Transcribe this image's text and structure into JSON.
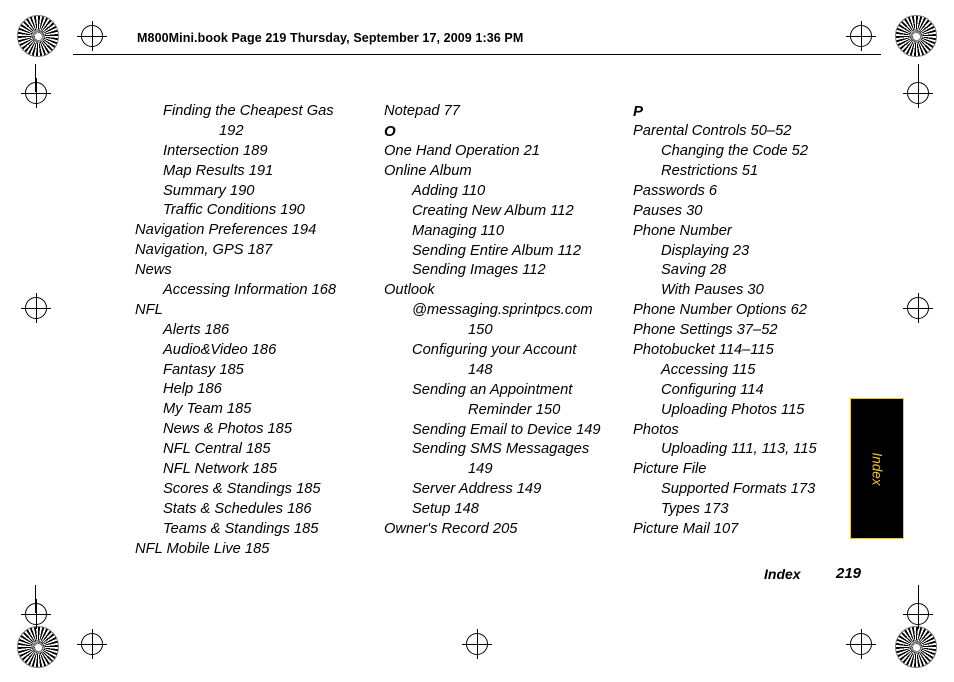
{
  "header": {
    "text": "M800Mini.book  Page 219  Thursday, September 17, 2009  1:36 PM"
  },
  "thumb_tab": {
    "label": "Index",
    "background": "#000000",
    "text_color": "#f5c518"
  },
  "footer": {
    "section": "Index",
    "page_number": "219"
  },
  "columns": [
    {
      "id": "column-1",
      "entries": [
        {
          "level": 1,
          "text": "Finding the Cheapest Gas",
          "cont": "192"
        },
        {
          "level": 1,
          "text": "Intersection 189"
        },
        {
          "level": 1,
          "text": "Map Results 191"
        },
        {
          "level": 1,
          "text": "Summary 190"
        },
        {
          "level": 1,
          "text": "Traffic Conditions 190"
        },
        {
          "level": 0,
          "text": "Navigation Preferences 194"
        },
        {
          "level": 0,
          "text": "Navigation, GPS 187"
        },
        {
          "level": 0,
          "text": "News"
        },
        {
          "level": 1,
          "text": "Accessing Information 168"
        },
        {
          "level": 0,
          "text": "NFL"
        },
        {
          "level": 1,
          "text": "Alerts 186"
        },
        {
          "level": 1,
          "text": "Audio&Video 186"
        },
        {
          "level": 1,
          "text": "Fantasy 185"
        },
        {
          "level": 1,
          "text": "Help 186"
        },
        {
          "level": 1,
          "text": "My Team 185"
        },
        {
          "level": 1,
          "text": "News & Photos 185"
        },
        {
          "level": 1,
          "text": "NFL Central 185"
        },
        {
          "level": 1,
          "text": "NFL Network 185"
        },
        {
          "level": 1,
          "text": "Scores & Standings 185"
        },
        {
          "level": 1,
          "text": "Stats & Schedules 186"
        },
        {
          "level": 1,
          "text": "Teams & Standings 185"
        },
        {
          "level": 0,
          "text": "NFL Mobile Live 185"
        }
      ]
    },
    {
      "id": "column-2",
      "entries": [
        {
          "level": 0,
          "text": "Notepad 77"
        },
        {
          "letter": "O"
        },
        {
          "level": 0,
          "text": "One Hand Operation 21"
        },
        {
          "level": 0,
          "text": "Online Album"
        },
        {
          "level": 1,
          "text": "Adding 110"
        },
        {
          "level": 1,
          "text": "Creating New Album 112"
        },
        {
          "level": 1,
          "text": "Managing 110"
        },
        {
          "level": 1,
          "text": "Sending Entire Album 112"
        },
        {
          "level": 1,
          "text": "Sending Images 112"
        },
        {
          "level": 0,
          "text": "Outlook"
        },
        {
          "level": 1,
          "text": "@messaging.sprintpcs.com",
          "cont": "150"
        },
        {
          "level": 1,
          "text": "Configuring your Account",
          "cont": "148"
        },
        {
          "level": 1,
          "text": "Sending an Appointment",
          "cont": "Reminder 150"
        },
        {
          "level": 1,
          "text": "Sending Email to Device 149"
        },
        {
          "level": 1,
          "text": "Sending SMS Messagages",
          "cont": "149"
        },
        {
          "level": 1,
          "text": "Server Address 149"
        },
        {
          "level": 1,
          "text": "Setup 148"
        },
        {
          "level": 0,
          "text": "Owner's Record 205"
        }
      ]
    },
    {
      "id": "column-3",
      "entries": [
        {
          "letter": "P"
        },
        {
          "level": 0,
          "text": "Parental Controls 50–52"
        },
        {
          "level": 1,
          "text": "Changing the Code 52"
        },
        {
          "level": 1,
          "text": "Restrictions 51"
        },
        {
          "level": 0,
          "text": "Passwords 6"
        },
        {
          "level": 0,
          "text": "Pauses 30"
        },
        {
          "level": 0,
          "text": "Phone Number"
        },
        {
          "level": 1,
          "text": "Displaying 23"
        },
        {
          "level": 1,
          "text": "Saving 28"
        },
        {
          "level": 1,
          "text": "With Pauses 30"
        },
        {
          "level": 0,
          "text": "Phone Number Options 62"
        },
        {
          "level": 0,
          "text": "Phone Settings 37–52"
        },
        {
          "level": 0,
          "text": "Photobucket 114–115"
        },
        {
          "level": 1,
          "text": "Accessing 115"
        },
        {
          "level": 1,
          "text": "Configuring 114"
        },
        {
          "level": 1,
          "text": "Uploading Photos 115"
        },
        {
          "level": 0,
          "text": "Photos"
        },
        {
          "level": 1,
          "text": "Uploading 111, 113, 115"
        },
        {
          "level": 0,
          "text": "Picture File"
        },
        {
          "level": 1,
          "text": "Supported Formats 173"
        },
        {
          "level": 1,
          "text": "Types 173"
        },
        {
          "level": 0,
          "text": "Picture Mail 107"
        }
      ]
    }
  ]
}
